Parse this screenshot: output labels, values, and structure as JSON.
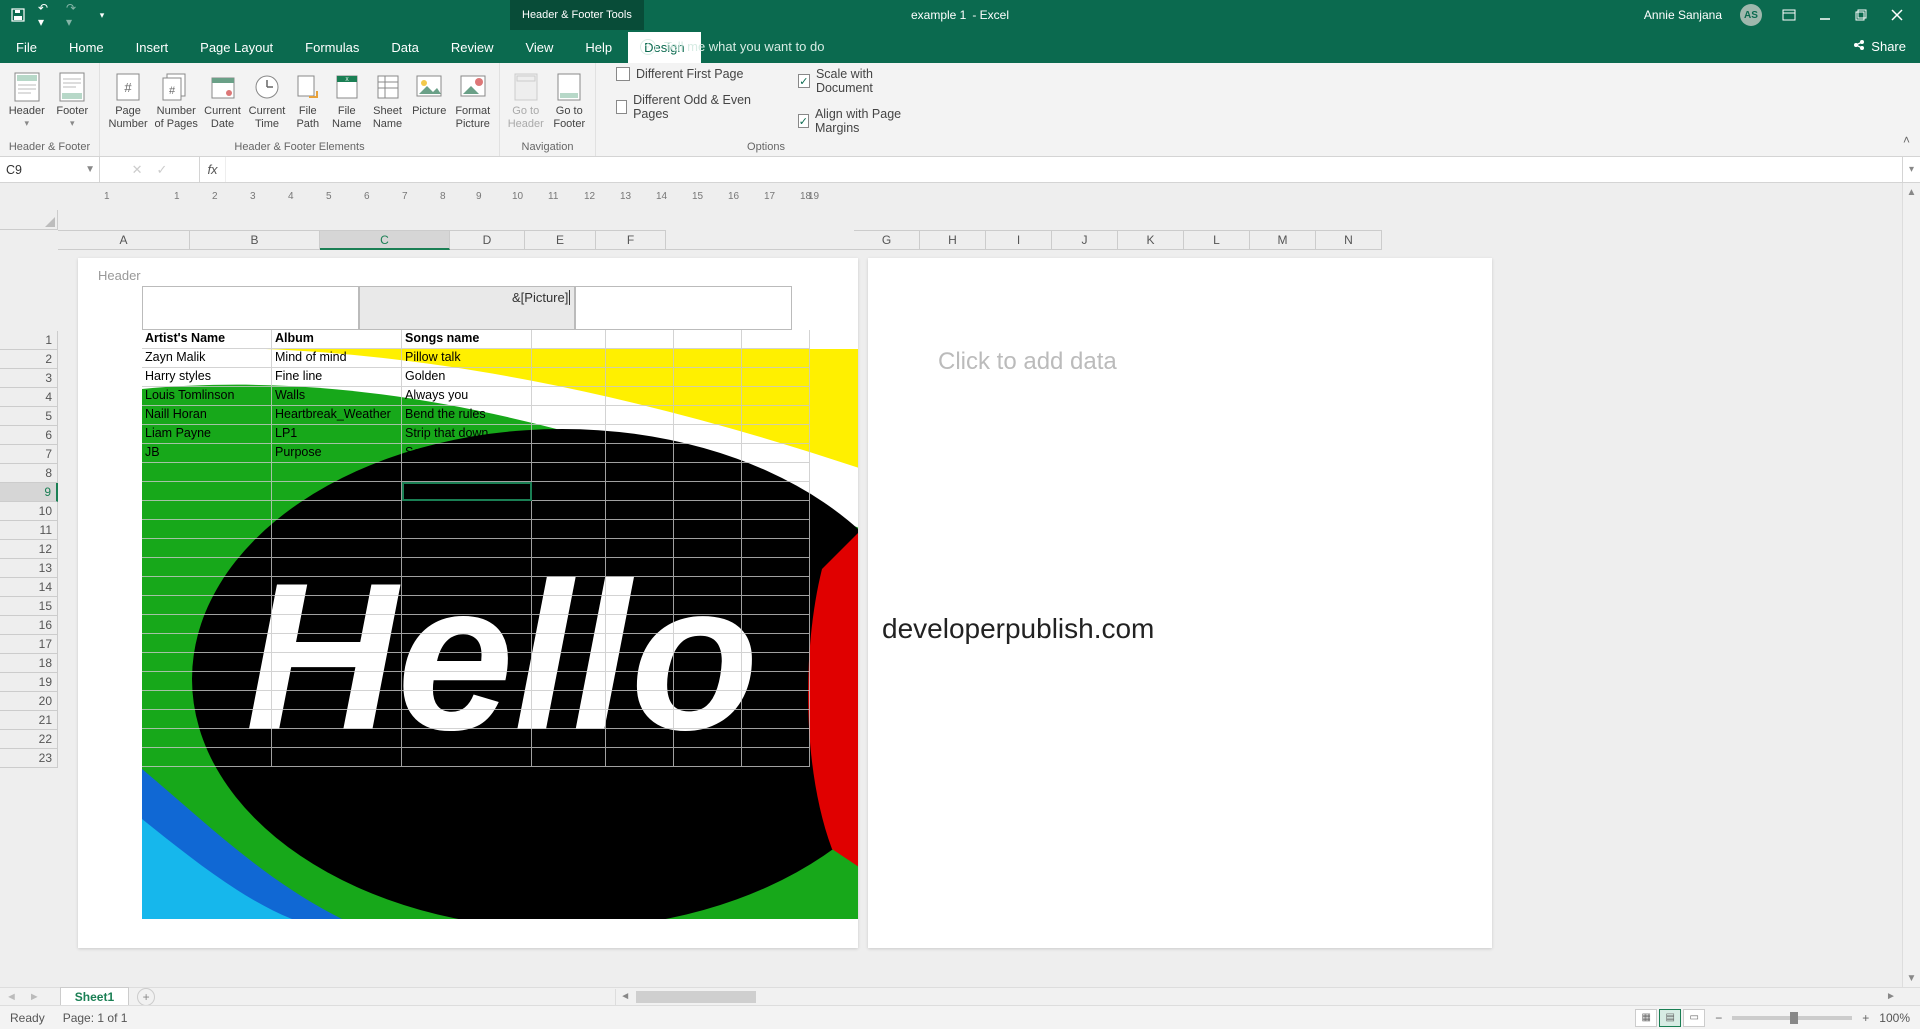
{
  "titlebar": {
    "tools_tab": "Header & Footer Tools",
    "doc_name": "example 1",
    "app_suffix": "  -  Excel",
    "user_name": "Annie Sanjana",
    "user_initials": "AS"
  },
  "menu": {
    "tabs": [
      "File",
      "Home",
      "Insert",
      "Page Layout",
      "Formulas",
      "Data",
      "Review",
      "View",
      "Help",
      "Design"
    ],
    "active_index": 9,
    "tell_me": "Tell me what you want to do",
    "share": "Share"
  },
  "ribbon": {
    "groups": {
      "hf": {
        "label": "Header & Footer",
        "items": [
          "Header",
          "Footer"
        ]
      },
      "elements": {
        "label": "Header & Footer Elements",
        "items": [
          "Page Number",
          "Number of Pages",
          "Current Date",
          "Current Time",
          "File Path",
          "File Name",
          "Sheet Name",
          "Picture",
          "Format Picture"
        ]
      },
      "nav": {
        "label": "Navigation",
        "items": [
          "Go to Header",
          "Go to Footer"
        ]
      },
      "options": {
        "label": "Options",
        "different_first": {
          "label": "Different First Page",
          "checked": false
        },
        "different_oe": {
          "label": "Different Odd & Even Pages",
          "checked": false
        },
        "scale": {
          "label": "Scale with Document",
          "checked": true
        },
        "align": {
          "label": "Align with Page Margins",
          "checked": true
        }
      }
    }
  },
  "namebox": {
    "ref": "C9"
  },
  "formula_bar": {
    "value": ""
  },
  "columns": [
    "A",
    "B",
    "C",
    "D",
    "E",
    "F",
    "G",
    "H",
    "I",
    "J",
    "K",
    "L",
    "M",
    "N"
  ],
  "selected_col_index": 2,
  "rows_shown": 23,
  "selected_row": 9,
  "page1": {
    "header_label": "Header",
    "header_center": "&[Picture]",
    "table": {
      "headers": [
        "Artist's Name",
        "Album",
        "Songs name"
      ],
      "rows": [
        [
          "Zayn Malik",
          "Mind of mind",
          "Pillow talk"
        ],
        [
          "Harry styles",
          "Fine line",
          "Golden"
        ],
        [
          "Louis Tomlinson",
          "Walls",
          "Always you"
        ],
        [
          "Naill Horan",
          "Heartbreak_Weather",
          "Bend the rules"
        ],
        [
          "Liam Payne",
          "LP1",
          "Strip that down"
        ],
        [
          "JB",
          "Purpose",
          "Sorry"
        ]
      ]
    }
  },
  "page2": {
    "placeholder": "Click to add data",
    "watermark": "developerpublish.com"
  },
  "sheet_tabs": {
    "active": "Sheet1"
  },
  "statusbar": {
    "ready": "Ready",
    "page_info": "Page: 1 of 1",
    "zoom": "100%"
  },
  "ruler_marks": [
    "1",
    "1",
    "2",
    "3",
    "4",
    "5",
    "6",
    "7",
    "8",
    "9",
    "10",
    "11",
    "12",
    "13",
    "14",
    "15",
    "16",
    "17",
    "18",
    "19"
  ]
}
